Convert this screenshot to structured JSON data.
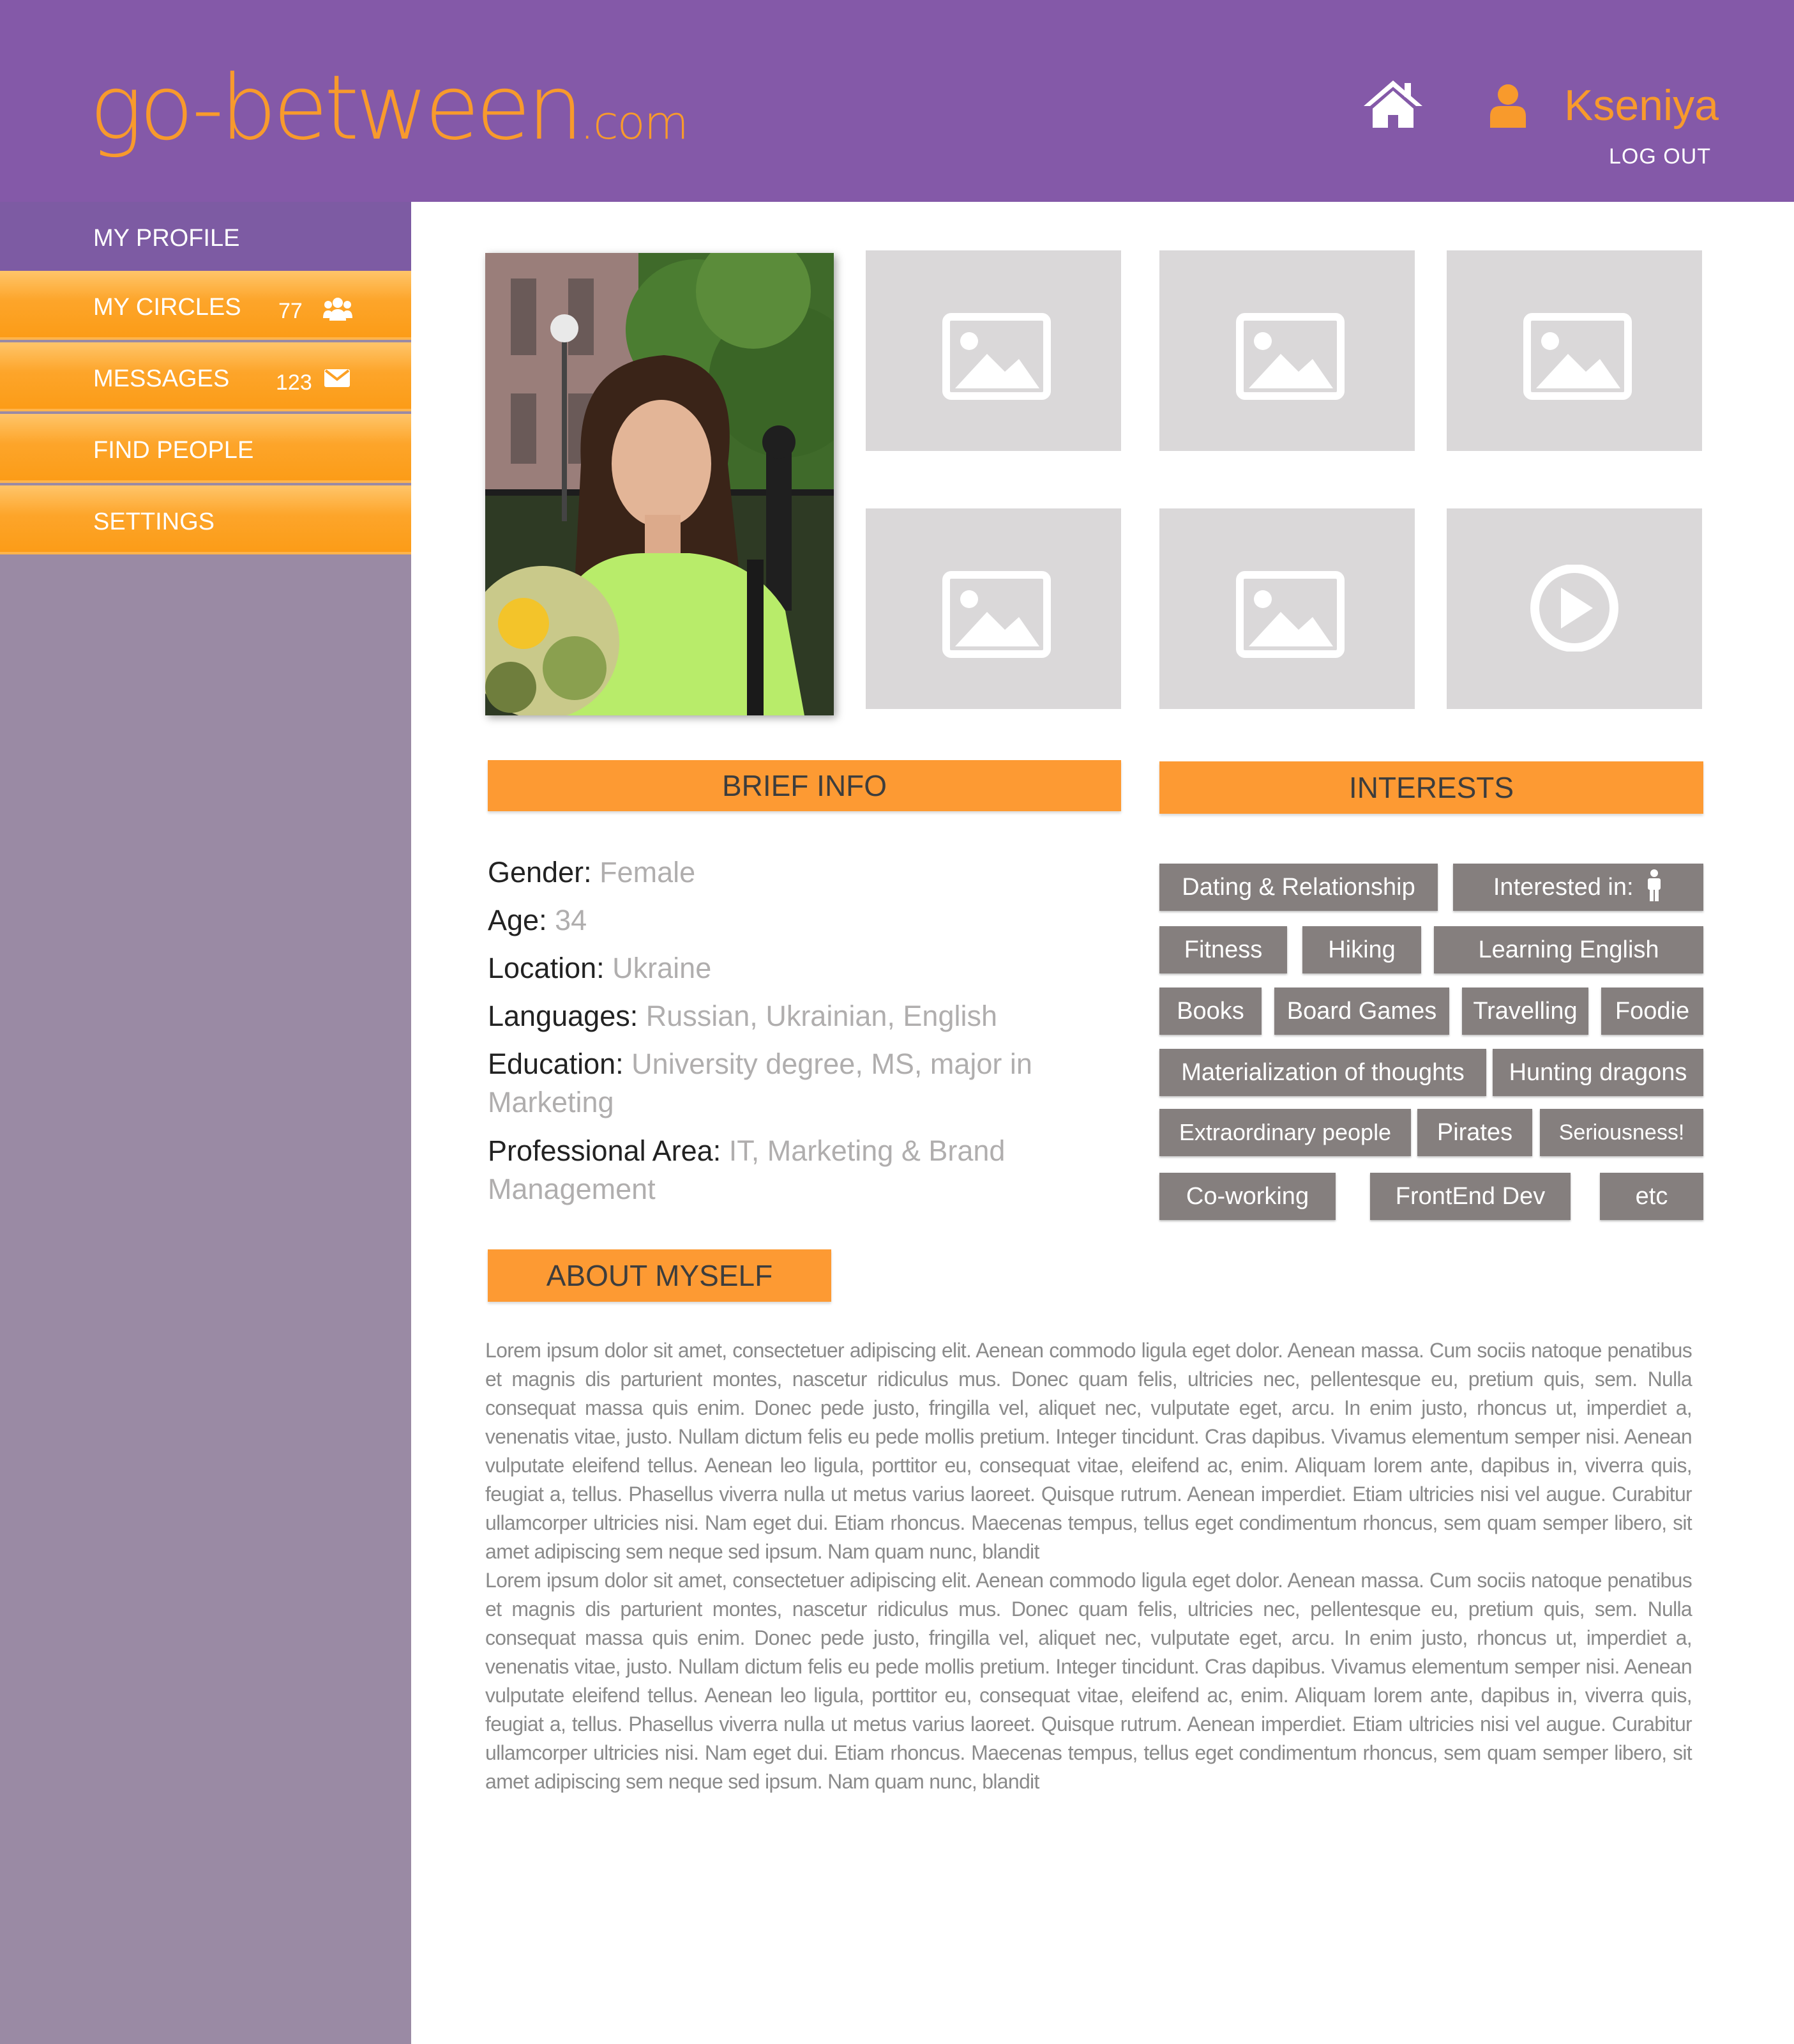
{
  "header": {
    "logo_main": "go-between",
    "logo_tld": ".com",
    "home_icon": "home-icon",
    "user_icon": "user-icon",
    "username": "Kseniya",
    "logout_label": "LOG OUT"
  },
  "sidebar": {
    "items": [
      {
        "label": "MY PROFILE",
        "active": true
      },
      {
        "label": "MY CIRCLES",
        "count": "77",
        "icon": "group-icon"
      },
      {
        "label": "MESSAGES",
        "count": "123",
        "icon": "envelope-icon"
      },
      {
        "label": "FIND PEOPLE"
      },
      {
        "label": "SETTINGS"
      }
    ]
  },
  "gallery": {
    "main_photo": "profile-photo",
    "thumbnails": [
      "image-placeholder",
      "image-placeholder",
      "image-placeholder",
      "image-placeholder",
      "image-placeholder",
      "video-placeholder"
    ]
  },
  "brief_info": {
    "title": "BRIEF INFO",
    "fields": [
      {
        "label": "Gender:",
        "value": "Female"
      },
      {
        "label": "Age:",
        "value": "34"
      },
      {
        "label": "Location:",
        "value": "Ukraine"
      },
      {
        "label": "Languages:",
        "value": "Russian, Ukrainian, English"
      },
      {
        "label": "Education:",
        "value": "University degree, MS, major in Marketing"
      },
      {
        "label": "Professional Area:",
        "value": "IT, Marketing & Brand Management"
      }
    ]
  },
  "interests": {
    "title": "INTERESTS",
    "tags": [
      "Dating & Relationship",
      "Interested in:",
      "Fitness",
      "Hiking",
      "Learning English",
      "Books",
      "Board Games",
      "Travelling",
      "Foodie",
      "Materialization of thoughts",
      "Hunting dragons",
      "Extraordinary people",
      "Pirates",
      "Seriousness!",
      "Co-working",
      "FrontEnd Dev",
      "etc"
    ]
  },
  "about": {
    "title": "ABOUT MYSELF",
    "paragraphs": [
      "Lorem ipsum dolor sit amet, consectetuer adipiscing elit. Aenean commodo ligula eget dolor. Aenean massa. Cum sociis natoque penatibus et magnis dis parturient montes, nascetur ridiculus mus. Donec quam felis, ultricies nec, pellentesque eu, pretium quis, sem. Nulla consequat massa quis enim. Donec pede justo, fringilla vel, aliquet nec, vulputate eget, arcu. In enim justo, rhoncus ut, imperdiet a, venenatis vitae, justo. Nullam dictum felis eu pede mollis pretium. Integer tincidunt. Cras dapibus. Vivamus elementum semper nisi. Aenean vulputate eleifend tellus. Aenean leo ligula, porttitor eu, consequat vitae, eleifend ac, enim. Aliquam lorem ante, dapibus in, viverra quis, feugiat a, tellus. Phasellus viverra nulla ut metus varius laoreet. Quisque rutrum. Aenean imperdiet. Etiam ultricies nisi vel augue. Curabitur ullamcorper ultricies nisi. Nam eget dui. Etiam rhoncus. Maecenas tempus, tellus eget condimentum rhoncus, sem quam semper libero, sit amet adipiscing sem neque sed ipsum. Nam quam nunc, blandit",
      "Lorem ipsum dolor sit amet, consectetuer adipiscing elit. Aenean commodo ligula eget dolor. Aenean massa. Cum sociis natoque penatibus et magnis dis parturient montes, nascetur ridiculus mus. Donec quam felis, ultricies nec, pellentesque eu, pretium quis, sem. Nulla consequat massa quis enim. Donec pede justo, fringilla vel, aliquet nec, vulputate eget, arcu. In enim justo, rhoncus ut, imperdiet a, venenatis vitae, justo. Nullam dictum felis eu pede mollis pretium. Integer tincidunt. Cras dapibus. Vivamus elementum semper nisi. Aenean vulputate eleifend tellus. Aenean leo ligula, porttitor eu, consequat vitae, eleifend ac, enim. Aliquam lorem ante, dapibus in, viverra quis, feugiat a, tellus. Phasellus viverra nulla ut metus varius laoreet. Quisque rutrum. Aenean imperdiet. Etiam ultricies nisi vel augue. Curabitur ullamcorper ultricies nisi. Nam eget dui. Etiam rhoncus. Maecenas tempus, tellus eget condimentum rhoncus, sem quam semper libero, sit amet adipiscing sem neque sed ipsum. Nam quam nunc, blandit"
    ]
  },
  "colors": {
    "header_bg": "#8459a8",
    "accent_orange": "#fd9a33",
    "sidebar_bg": "#9a8aa4",
    "tag_bg": "#857f7e",
    "placeholder_bg": "#dad8d9"
  }
}
